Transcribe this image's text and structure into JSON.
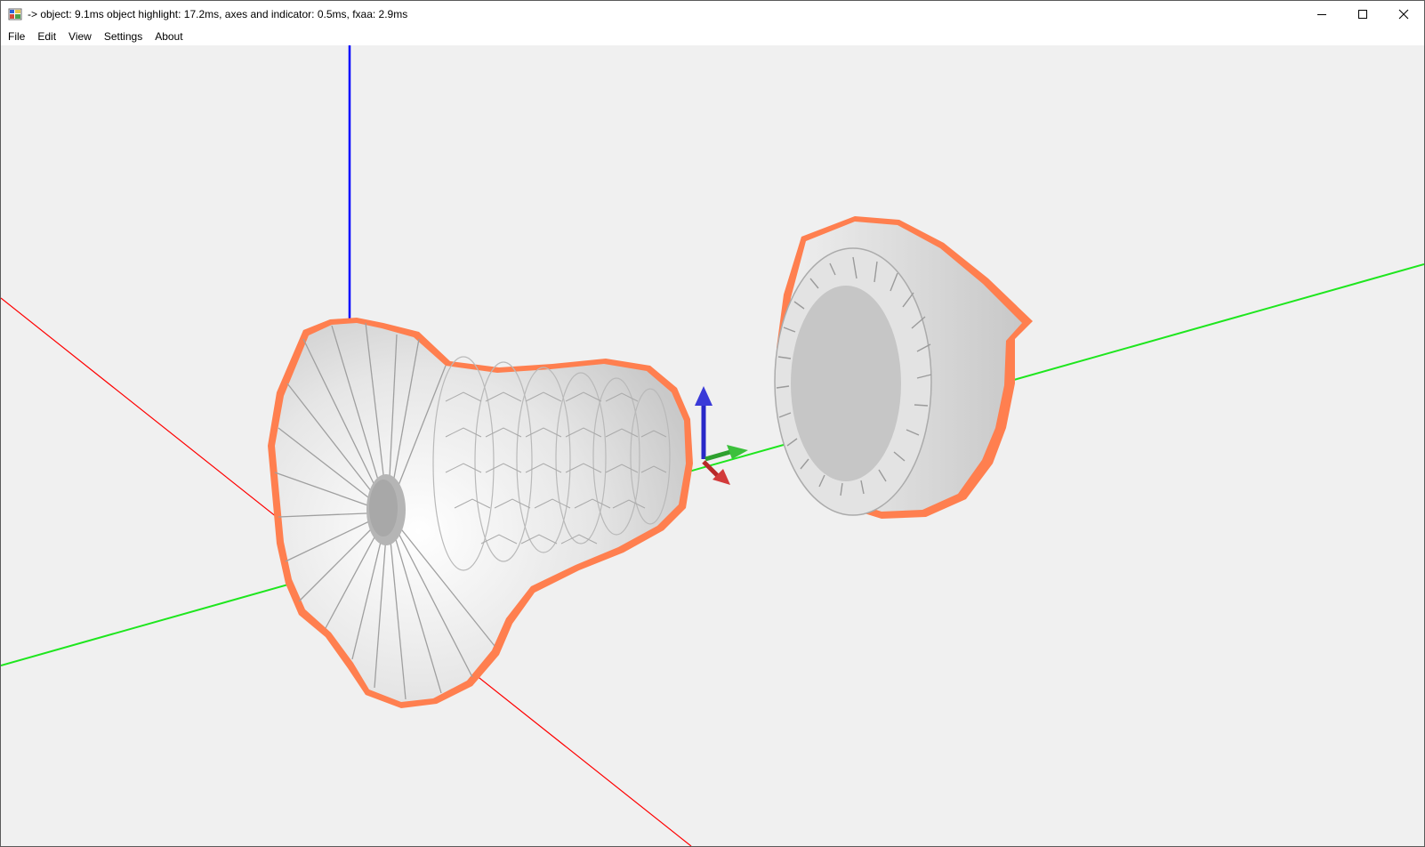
{
  "window": {
    "title": "-> object: 9.1ms object highlight: 17.2ms, axes and indicator: 0.5ms, fxaa: 2.9ms",
    "icon": "app-window-icon",
    "controls": [
      "minimize-icon",
      "maximize-icon",
      "close-icon"
    ]
  },
  "menu": {
    "items": [
      {
        "label": "File"
      },
      {
        "label": "Edit"
      },
      {
        "label": "View"
      },
      {
        "label": "Settings"
      },
      {
        "label": "About"
      }
    ]
  },
  "viewport": {
    "background": "#f0f0f0",
    "axis_colors": {
      "x": "#ff0000",
      "y": "#00e000",
      "z": "#0000ff"
    },
    "highlight_color": "#ff7f4f",
    "objects": [
      "turbine-rotor",
      "turbine-casing"
    ],
    "orientation_indicator": "xyz-gizmo"
  }
}
